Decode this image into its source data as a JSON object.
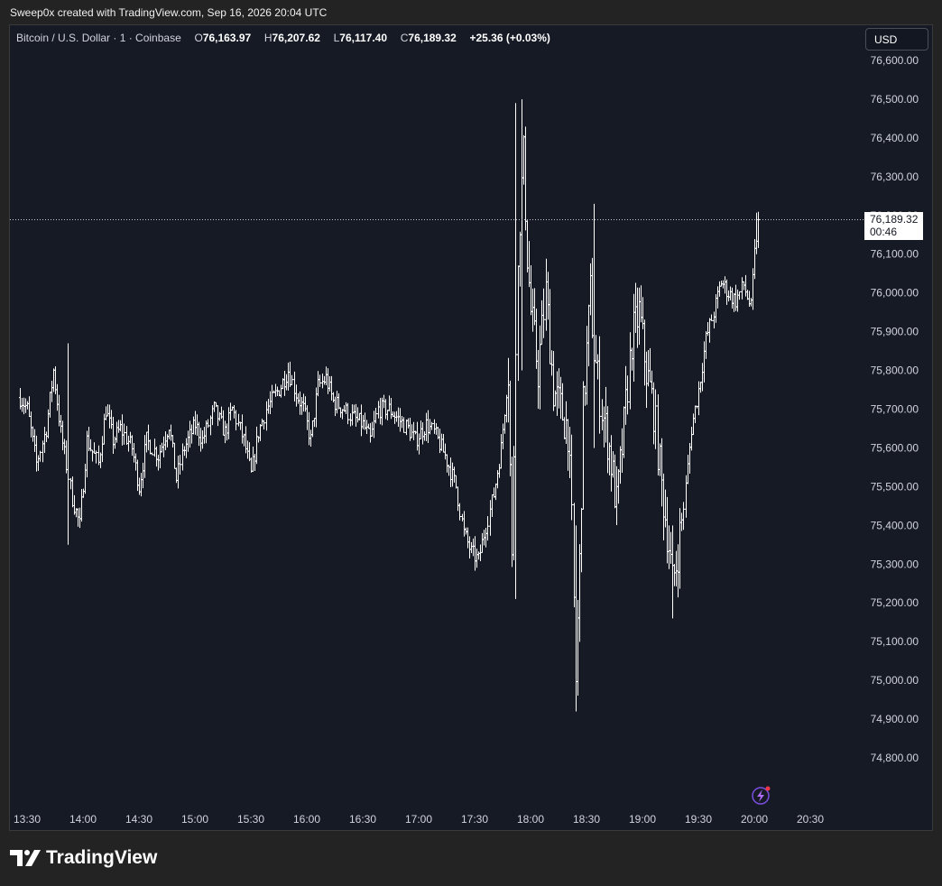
{
  "header": {
    "text": "Sweep0x created with TradingView.com, Sep 16, 2026 20:04 UTC"
  },
  "legend": {
    "symbol": "Bitcoin / U.S. Dollar · 1 · Coinbase",
    "open_label": "O",
    "open": "76,163.97",
    "high_label": "H",
    "high": "76,207.62",
    "low_label": "L",
    "low": "76,117.40",
    "close_label": "C",
    "close": "76,189.32",
    "change": "+25.36 (+0.03%)"
  },
  "currency_button": {
    "label": "USD"
  },
  "price_tag": {
    "price": "76,189.32",
    "countdown": "00:46"
  },
  "footer": {
    "brand": "TradingView"
  },
  "colors": {
    "background": "#161a25",
    "bars": "#ffffff",
    "text": "#d1d4dc",
    "frame": "#232323"
  },
  "chart_data": {
    "type": "ohlc",
    "y_axis_ticks": [
      "76,600.00",
      "76,500.00",
      "76,400.00",
      "76,300.00",
      "76,200.00",
      "76,100.00",
      "76,000.00",
      "75,900.00",
      "75,800.00",
      "75,700.00",
      "75,600.00",
      "75,500.00",
      "75,400.00",
      "75,300.00",
      "75,200.00",
      "75,100.00",
      "75,000.00",
      "74,900.00",
      "74,800.00"
    ],
    "y_tick_values": [
      76600,
      76500,
      76400,
      76300,
      76200,
      76100,
      76000,
      75900,
      75800,
      75700,
      75600,
      75500,
      75400,
      75300,
      75200,
      75100,
      75000,
      74900,
      74800
    ],
    "x_axis_ticks": [
      "13:30",
      "14:00",
      "14:30",
      "15:00",
      "15:30",
      "16:00",
      "16:30",
      "17:00",
      "17:30",
      "18:00",
      "18:30",
      "19:00",
      "19:30",
      "20:00",
      "20:30"
    ],
    "x_tick_minutes": [
      810,
      840,
      870,
      900,
      930,
      960,
      990,
      1020,
      1050,
      1080,
      1110,
      1140,
      1170,
      1200,
      1230
    ],
    "ylim": [
      74700,
      76700
    ],
    "xlim": [
      806,
      1268
    ],
    "last_price": 76189.32,
    "interval_minutes": 1,
    "keypoints": [
      [
        806,
        75730
      ],
      [
        810,
        75700
      ],
      [
        815,
        75560
      ],
      [
        820,
        75650
      ],
      [
        824,
        75800
      ],
      [
        828,
        75640
      ],
      [
        834,
        75470
      ],
      [
        838,
        75400
      ],
      [
        842,
        75620
      ],
      [
        848,
        75560
      ],
      [
        852,
        75700
      ],
      [
        856,
        75620
      ],
      [
        860,
        75650
      ],
      [
        866,
        75600
      ],
      [
        870,
        75500
      ],
      [
        874,
        75620
      ],
      [
        880,
        75580
      ],
      [
        886,
        75660
      ],
      [
        890,
        75520
      ],
      [
        894,
        75600
      ],
      [
        900,
        75660
      ],
      [
        904,
        75620
      ],
      [
        910,
        75700
      ],
      [
        916,
        75640
      ],
      [
        920,
        75700
      ],
      [
        926,
        75620
      ],
      [
        930,
        75530
      ],
      [
        934,
        75640
      ],
      [
        938,
        75700
      ],
      [
        946,
        75760
      ],
      [
        950,
        75800
      ],
      [
        954,
        75740
      ],
      [
        958,
        75700
      ],
      [
        962,
        75620
      ],
      [
        966,
        75760
      ],
      [
        970,
        75780
      ],
      [
        974,
        75720
      ],
      [
        980,
        75700
      ],
      [
        984,
        75680
      ],
      [
        990,
        75660
      ],
      [
        994,
        75620
      ],
      [
        998,
        75700
      ],
      [
        1004,
        75700
      ],
      [
        1008,
        75680
      ],
      [
        1014,
        75650
      ],
      [
        1018,
        75620
      ],
      [
        1024,
        75660
      ],
      [
        1028,
        75640
      ],
      [
        1034,
        75580
      ],
      [
        1040,
        75500
      ],
      [
        1044,
        75380
      ],
      [
        1048,
        75330
      ],
      [
        1052,
        75310
      ],
      [
        1056,
        75400
      ],
      [
        1060,
        75480
      ],
      [
        1064,
        75600
      ],
      [
        1068,
        75800
      ],
      [
        1070,
        75300
      ],
      [
        1072,
        75900
      ],
      [
        1074,
        76200
      ],
      [
        1076,
        76350
      ],
      [
        1078,
        76100
      ],
      [
        1080,
        75950
      ],
      [
        1084,
        75800
      ],
      [
        1088,
        76000
      ],
      [
        1092,
        75750
      ],
      [
        1096,
        75700
      ],
      [
        1100,
        75650
      ],
      [
        1102,
        75400
      ],
      [
        1104,
        75000
      ],
      [
        1106,
        75300
      ],
      [
        1108,
        75700
      ],
      [
        1112,
        76000
      ],
      [
        1114,
        75850
      ],
      [
        1118,
        75700
      ],
      [
        1122,
        75600
      ],
      [
        1126,
        75450
      ],
      [
        1130,
        75650
      ],
      [
        1134,
        75880
      ],
      [
        1138,
        75950
      ],
      [
        1142,
        75800
      ],
      [
        1146,
        75700
      ],
      [
        1150,
        75500
      ],
      [
        1154,
        75350
      ],
      [
        1156,
        75250
      ],
      [
        1158,
        75300
      ],
      [
        1162,
        75450
      ],
      [
        1166,
        75650
      ],
      [
        1170,
        75750
      ],
      [
        1174,
        75880
      ],
      [
        1178,
        75950
      ],
      [
        1182,
        76030
      ],
      [
        1186,
        76000
      ],
      [
        1190,
        75980
      ],
      [
        1194,
        76020
      ],
      [
        1198,
        75960
      ],
      [
        1200,
        76100
      ],
      [
        1202,
        76189
      ]
    ],
    "extremes": [
      [
        832,
        75350,
        75870
      ],
      [
        1072,
        75210,
        76490
      ],
      [
        1075,
        75800,
        76500
      ],
      [
        1104,
        74920,
        75400
      ],
      [
        1114,
        75600,
        76230
      ],
      [
        1156,
        75160,
        75400
      ],
      [
        1201,
        76100,
        76207
      ]
    ]
  }
}
